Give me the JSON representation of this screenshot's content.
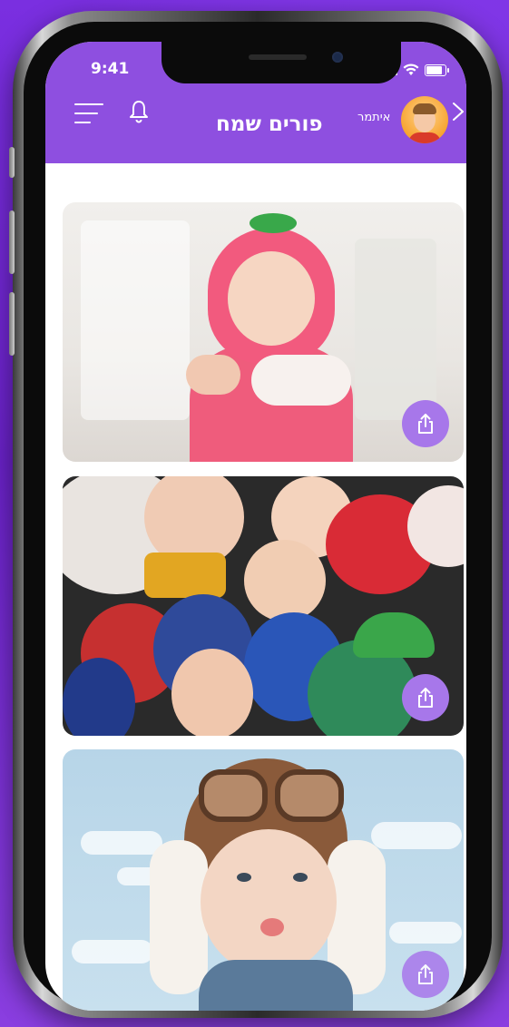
{
  "status_bar": {
    "time": "9:41"
  },
  "header": {
    "title": "פורים שמח",
    "username": "איתמר"
  },
  "icons": {
    "menu": "menu-icon",
    "bell": "bell-icon",
    "chevron": "chevron-right-icon",
    "share": "share-icon"
  },
  "colors": {
    "header_bg": "#8e4fe0",
    "share_button": "#a777ea",
    "page_bg": "#7a2fe0"
  },
  "photos": [
    {
      "subject": "baby-strawberry-costume"
    },
    {
      "subject": "kids-costumes-group"
    },
    {
      "subject": "baby-pilot-costume"
    }
  ]
}
